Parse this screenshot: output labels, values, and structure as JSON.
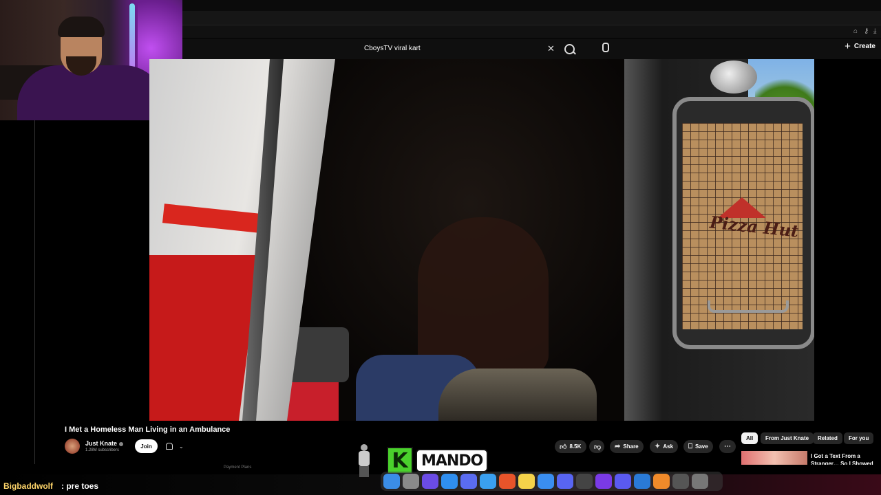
{
  "search": {
    "query": "CboysTV viral kart"
  },
  "header": {
    "create_label": "Create"
  },
  "video": {
    "title": "I Met a Homeless Man Living in an Ambulance",
    "box_text": "Pizza Hut",
    "channel": {
      "name": "Just Knate",
      "subscribers": "1.28M subscribers",
      "join_label": "Join"
    },
    "actions": {
      "likes": "8.5K",
      "share": "Share",
      "ask": "Ask",
      "save": "Save"
    },
    "below_text": "Payment Plans"
  },
  "chips": [
    "All",
    "From Just Knate",
    "Related",
    "For you"
  ],
  "recommendation": {
    "title": "I Got a Text From a Stranger… So I Showed Up"
  },
  "chat": {
    "user": "Bigbaddwolf",
    "message": ": pre toes"
  },
  "overlay_logo": {
    "k": "K",
    "text": "MANDO"
  },
  "colors": {
    "chat_user": "#ffd66b",
    "logo_green": "#4ad12c",
    "yt_bg": "#0f0f0f"
  },
  "dock": [
    {
      "name": "finder-icon",
      "bg": "#3b8de6"
    },
    {
      "name": "settings-icon",
      "bg": "#8a8a8a"
    },
    {
      "name": "vpn-icon",
      "bg": "#6b4ce6"
    },
    {
      "name": "app-store-icon",
      "bg": "#2f8ff0"
    },
    {
      "name": "arc-browser-icon",
      "bg": "#5a6cf0"
    },
    {
      "name": "safari-icon",
      "bg": "#3aa0f0"
    },
    {
      "name": "brave-icon",
      "bg": "#e8542a"
    },
    {
      "name": "notes-icon",
      "bg": "#f4d24a"
    },
    {
      "name": "mail-icon",
      "bg": "#3a8ef0"
    },
    {
      "name": "discord-icon",
      "bg": "#5865f2"
    },
    {
      "name": "activity-icon",
      "bg": "#444"
    },
    {
      "name": "iew-app-icon",
      "bg": "#7a3ae6"
    },
    {
      "name": "launchpad-icon",
      "bg": "#5a5af0"
    },
    {
      "name": "finder-alt-icon",
      "bg": "#2a7ad6"
    },
    {
      "name": "vlc-icon",
      "bg": "#f08a2a"
    },
    {
      "name": "obs-icon",
      "bg": "#555"
    },
    {
      "name": "trash-icon",
      "bg": "#777"
    }
  ]
}
